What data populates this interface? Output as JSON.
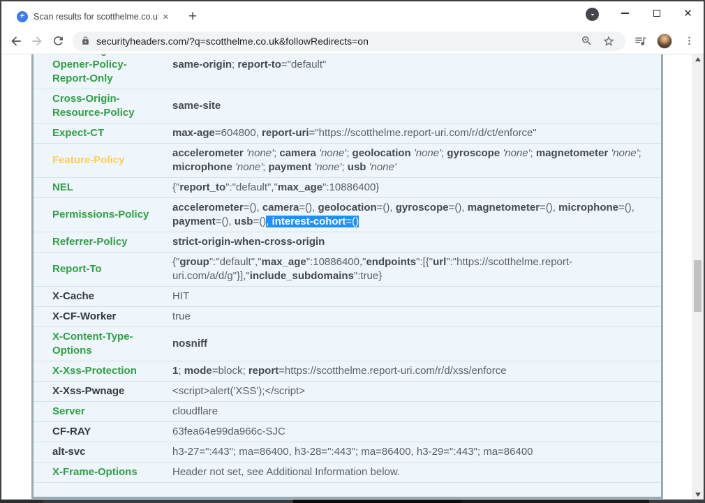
{
  "colors": {
    "green": "#2f9e44",
    "orange": "#fdce55",
    "darkname": "#32383e",
    "highlight": "#1e90ff",
    "valreg": "#5a6065",
    "valbold": "#45494e",
    "sep": "#d8e1e7",
    "panelbg": "#eef6fc",
    "panelborder": "#93abb1"
  },
  "browser": {
    "tab_title": "Scan results for scotthelme.co.uk",
    "url": "securityheaders.com/?q=scotthelme.co.uk&followRedirects=on",
    "favicon_glyph": "★",
    "tab_close_glyph": "✕",
    "new_tab_glyph": "+",
    "window_close_glyph": "✕"
  },
  "table": {
    "rows": [
      {
        "name": "Cross-Origin-\nOpener-Policy-\nReport-Only",
        "status": "green",
        "value": [
          [
            {
              "t": "same-origin",
              "f": "b"
            },
            {
              "t": "; "
            },
            {
              "t": "report-to",
              "f": "b"
            },
            {
              "t": "=\"default\""
            }
          ]
        ]
      },
      {
        "name": "Cross-Origin-\nResource-Policy",
        "status": "green",
        "value": [
          [
            {
              "t": "same-site",
              "f": "b"
            }
          ]
        ]
      },
      {
        "name": "Expect-CT",
        "status": "green",
        "value": [
          [
            {
              "t": "max-age",
              "f": "b"
            },
            {
              "t": "=604800, "
            },
            {
              "t": "report-uri",
              "f": "b"
            },
            {
              "t": "=\"https://scotthelme.report-uri.com/r/d/ct/enforce\""
            }
          ]
        ]
      },
      {
        "name": "Feature-Policy",
        "status": "orange",
        "value": [
          [
            {
              "t": "accelerometer",
              "f": "b"
            },
            {
              "t": " "
            },
            {
              "t": "'none'",
              "f": "i"
            },
            {
              "t": "; "
            },
            {
              "t": "camera",
              "f": "b"
            },
            {
              "t": " "
            },
            {
              "t": "'none'",
              "f": "i"
            },
            {
              "t": "; "
            },
            {
              "t": "geolocation",
              "f": "b"
            },
            {
              "t": " "
            },
            {
              "t": "'none'",
              "f": "i"
            },
            {
              "t": "; "
            },
            {
              "t": "gyroscope",
              "f": "b"
            },
            {
              "t": " "
            },
            {
              "t": "'none'",
              "f": "i"
            },
            {
              "t": "; "
            },
            {
              "t": "magnetometer",
              "f": "b"
            },
            {
              "t": " "
            },
            {
              "t": "'none'",
              "f": "i"
            },
            {
              "t": ";"
            }
          ],
          [
            {
              "t": "microphone",
              "f": "b"
            },
            {
              "t": " "
            },
            {
              "t": "'none'",
              "f": "i"
            },
            {
              "t": "; "
            },
            {
              "t": "payment",
              "f": "b"
            },
            {
              "t": " "
            },
            {
              "t": "'none'",
              "f": "i"
            },
            {
              "t": "; "
            },
            {
              "t": "usb",
              "f": "b"
            },
            {
              "t": " "
            },
            {
              "t": "'none'",
              "f": "i"
            }
          ]
        ]
      },
      {
        "name": "NEL",
        "status": "green",
        "value": [
          [
            {
              "t": "{\""
            },
            {
              "t": "report_to",
              "f": "b"
            },
            {
              "t": "\":\"default\",\""
            },
            {
              "t": "max_age",
              "f": "b"
            },
            {
              "t": "\":10886400}"
            }
          ]
        ]
      },
      {
        "name": "Permissions-Policy",
        "status": "green",
        "value": [
          [
            {
              "t": "accelerometer",
              "f": "b"
            },
            {
              "t": "=(), "
            },
            {
              "t": "camera",
              "f": "b"
            },
            {
              "t": "=(), "
            },
            {
              "t": "geolocation",
              "f": "b"
            },
            {
              "t": "=(), "
            },
            {
              "t": "gyroscope",
              "f": "b"
            },
            {
              "t": "=(), "
            },
            {
              "t": "magnetometer",
              "f": "b"
            },
            {
              "t": "=(), "
            },
            {
              "t": "microphone",
              "f": "b"
            },
            {
              "t": "=(),"
            }
          ],
          [
            {
              "t": "payment",
              "f": "b"
            },
            {
              "t": "=(), "
            },
            {
              "t": "usb",
              "f": "b"
            },
            {
              "t": "=()"
            },
            {
              "t": ", ",
              "hl": true
            },
            {
              "t": "interest-cohort",
              "f": "b",
              "hl": true
            },
            {
              "t": "=()",
              "hl": true
            }
          ]
        ]
      },
      {
        "name": "Referrer-Policy",
        "status": "green",
        "value": [
          [
            {
              "t": "strict-origin-when-cross-origin",
              "f": "b"
            }
          ]
        ]
      },
      {
        "name": "Report-To",
        "status": "green",
        "value": [
          [
            {
              "t": "{\""
            },
            {
              "t": "group",
              "f": "b"
            },
            {
              "t": "\":\"default\",\""
            },
            {
              "t": "max_age",
              "f": "b"
            },
            {
              "t": "\":10886400,\""
            },
            {
              "t": "endpoints",
              "f": "b"
            },
            {
              "t": "\":[{\""
            },
            {
              "t": "url",
              "f": "b"
            },
            {
              "t": "\":\"https://scotthelme.report-"
            }
          ],
          [
            {
              "t": "uri.com/a/d/g\"}],\""
            },
            {
              "t": "include_subdomains",
              "f": "b"
            },
            {
              "t": "\":true}"
            }
          ]
        ]
      },
      {
        "name": "X-Cache",
        "status": "dark",
        "value": [
          [
            {
              "t": "HIT"
            }
          ]
        ]
      },
      {
        "name": "X-CF-Worker",
        "status": "dark",
        "value": [
          [
            {
              "t": "true"
            }
          ]
        ]
      },
      {
        "name": "X-Content-Type-\nOptions",
        "status": "green",
        "value": [
          [
            {
              "t": "nosniff",
              "f": "b"
            }
          ]
        ]
      },
      {
        "name": "X-Xss-Protection",
        "status": "green",
        "value": [
          [
            {
              "t": "1",
              "f": "b"
            },
            {
              "t": "; "
            },
            {
              "t": "mode",
              "f": "b"
            },
            {
              "t": "=block; "
            },
            {
              "t": "report",
              "f": "b"
            },
            {
              "t": "=https://scotthelme.report-uri.com/r/d/xss/enforce"
            }
          ]
        ]
      },
      {
        "name": "X-Xss-Pwnage",
        "status": "dark",
        "value": [
          [
            {
              "t": "<script>alert('XSS');</script>"
            }
          ]
        ]
      },
      {
        "name": "Server",
        "status": "green",
        "value": [
          [
            {
              "t": "cloudflare"
            }
          ]
        ]
      },
      {
        "name": "CF-RAY",
        "status": "dark",
        "value": [
          [
            {
              "t": "63fea64e99da966c-SJC"
            }
          ]
        ]
      },
      {
        "name": "alt-svc",
        "status": "dark",
        "value": [
          [
            {
              "t": "h3-27=\":443\"; ma=86400, h3-28=\":443\"; ma=86400, h3-29=\":443\"; ma=86400"
            }
          ]
        ]
      },
      {
        "name": "X-Frame-Options",
        "status": "green",
        "value": [
          [
            {
              "t": "Header not set, see Additional Information below."
            }
          ]
        ]
      }
    ]
  }
}
